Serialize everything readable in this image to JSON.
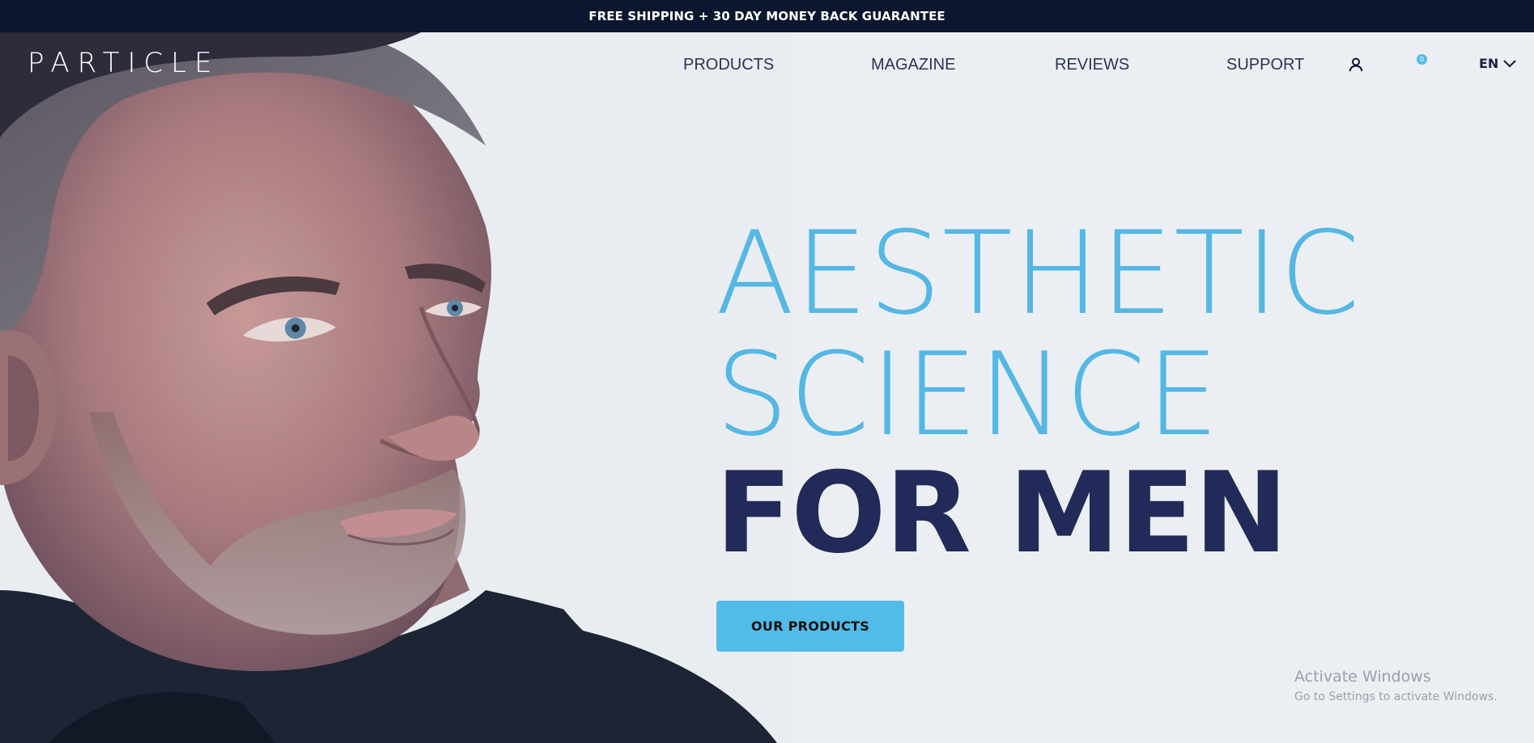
{
  "promo_bar": {
    "text": "FREE SHIPPING + 30 DAY MONEY BACK GUARANTEE"
  },
  "header": {
    "logo": "PARTICLE",
    "nav": [
      {
        "label": "PRODUCTS"
      },
      {
        "label": "MAGAZINE"
      },
      {
        "label": "REVIEWS"
      },
      {
        "label": "SUPPORT"
      }
    ],
    "account_icon": "user-icon",
    "cart_icon": "cart-icon",
    "cart_count": "0",
    "language": "EN",
    "language_icon": "chevron-down-icon"
  },
  "hero": {
    "line1": "AESTHETIC",
    "line2": "SCIENCE",
    "line3": "FOR MEN",
    "cta_label": "OUR PRODUCTS",
    "image_subject": "man-portrait"
  },
  "os_watermark": {
    "title": "Activate Windows",
    "subtitle": "Go to Settings to activate Windows."
  },
  "colors": {
    "page_bg": "#ebeff4",
    "promo_bg": "#0b1630",
    "accent_blue": "#55b7e3",
    "navy": "#212a58",
    "nav_text": "#2b3353"
  }
}
